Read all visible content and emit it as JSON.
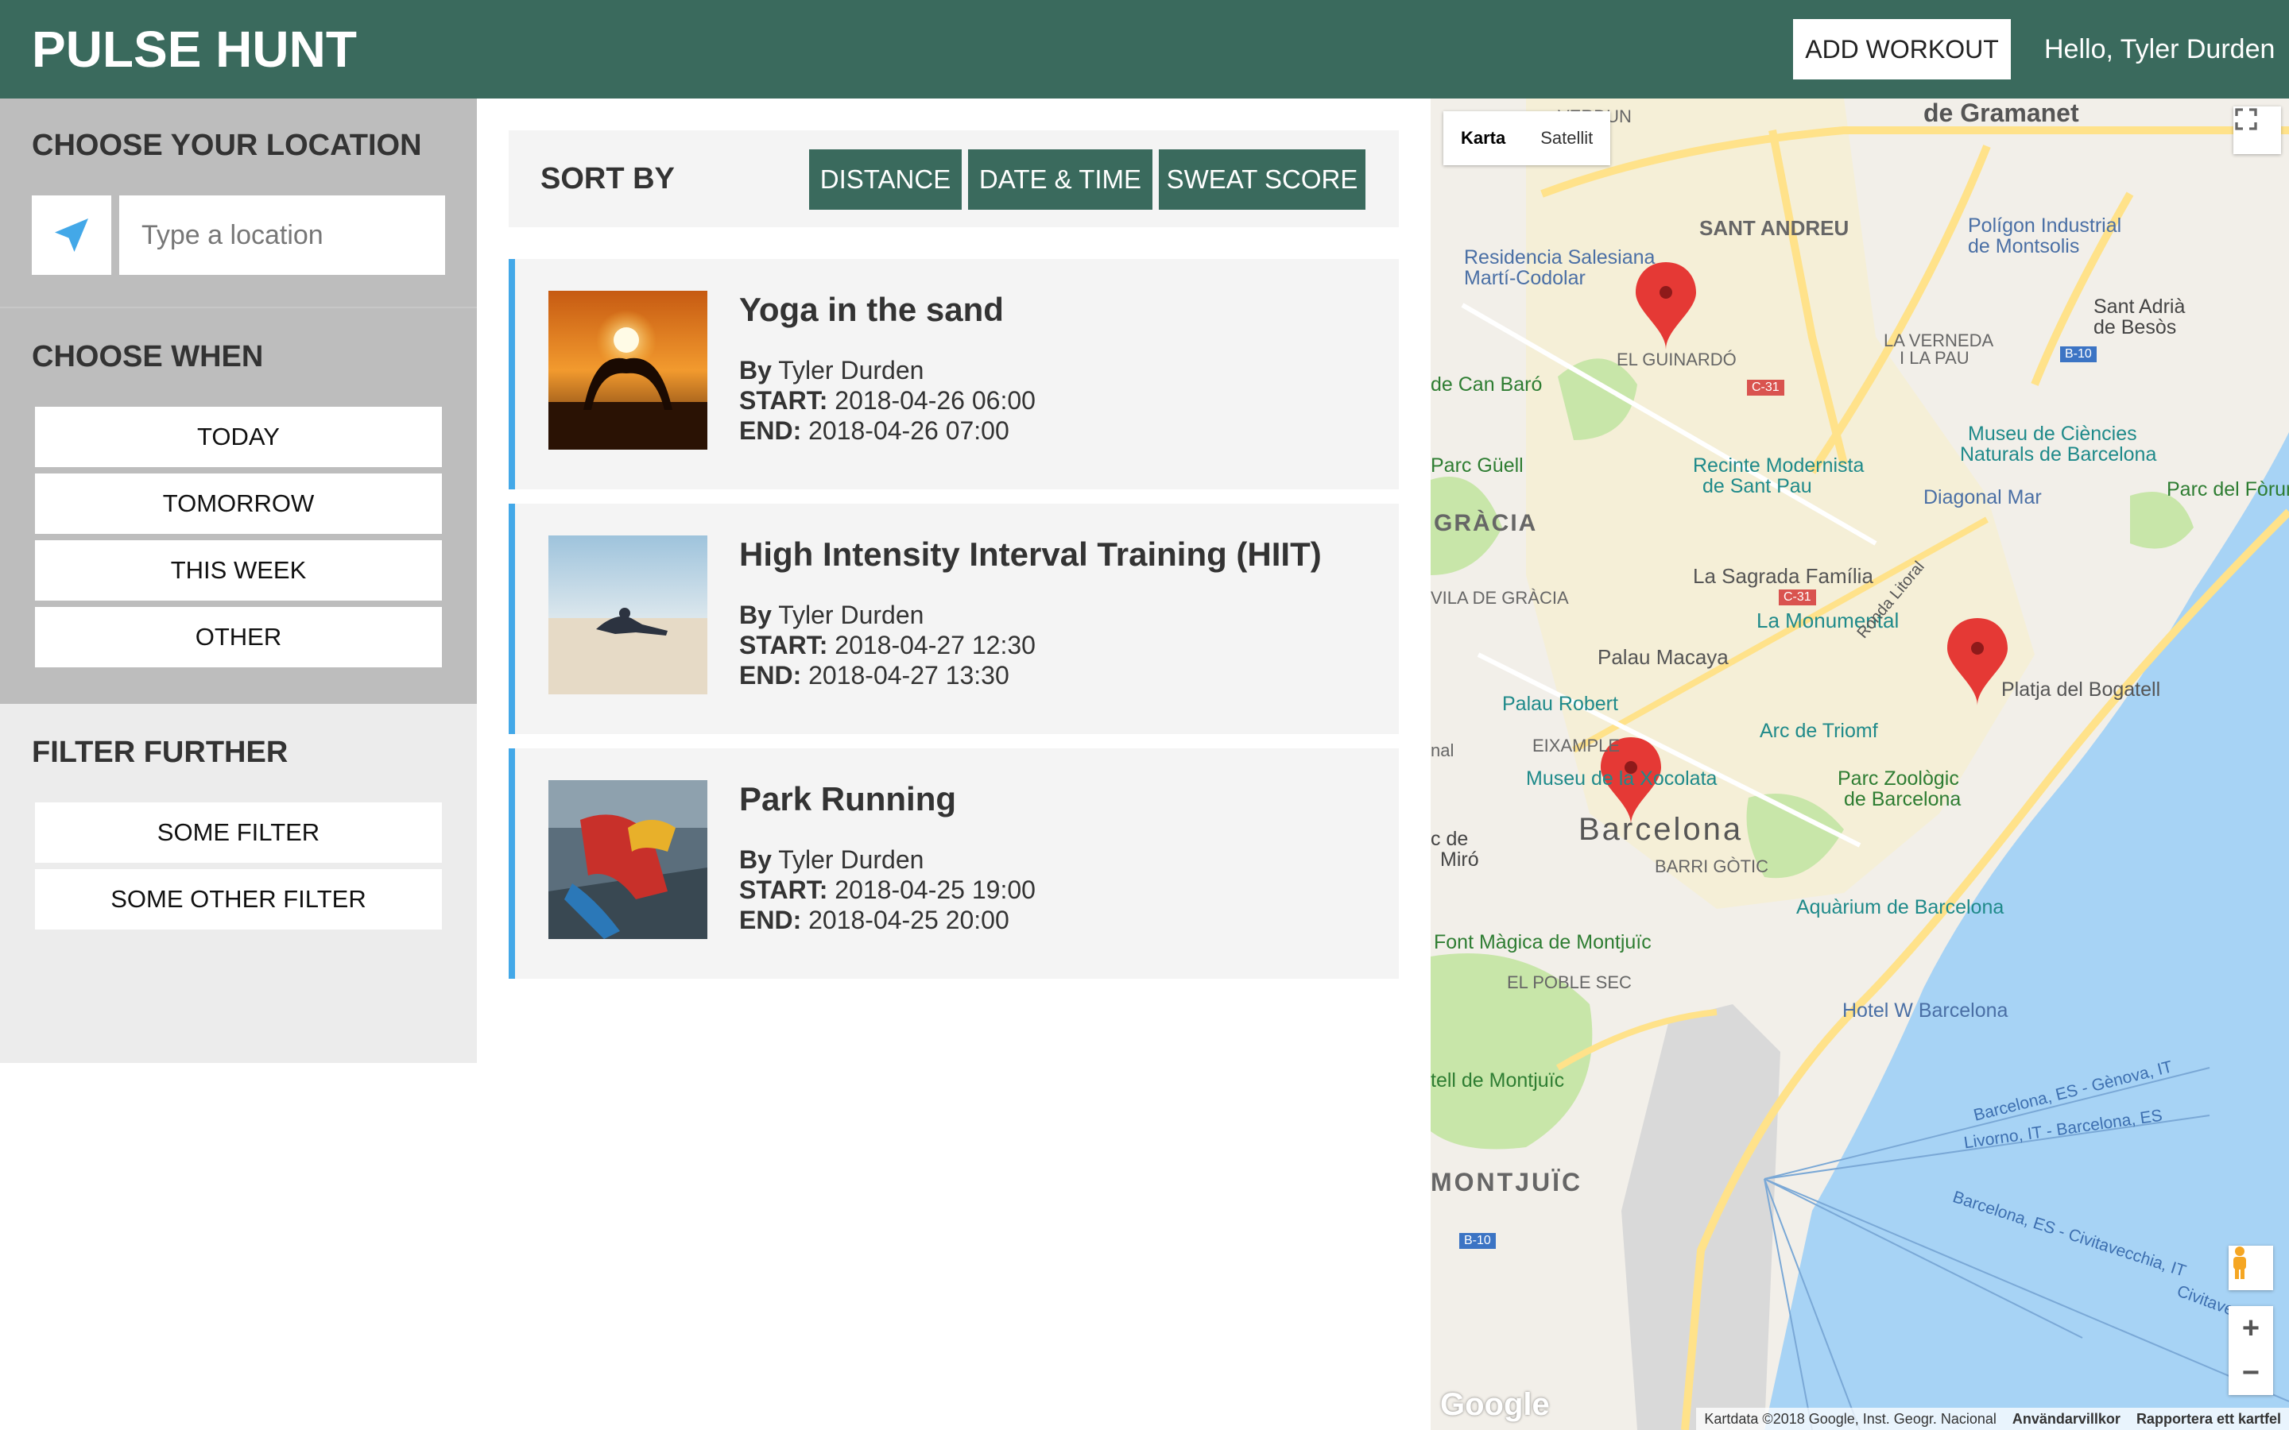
{
  "header": {
    "logo": "PULSE HUNT",
    "add_workout": "ADD WORKOUT",
    "greeting": "Hello, Tyler Durden"
  },
  "sidebar": {
    "location": {
      "title": "CHOOSE YOUR LOCATION",
      "placeholder": "Type a location",
      "icon": "navigation-arrow-icon"
    },
    "when": {
      "title": "CHOOSE WHEN",
      "options": [
        "TODAY",
        "TOMORROW",
        "THIS WEEK",
        "OTHER"
      ]
    },
    "filter": {
      "title": "FILTER FURTHER",
      "options": [
        "SOME FILTER",
        "SOME OTHER FILTER"
      ]
    }
  },
  "sort": {
    "label": "SORT BY",
    "options": [
      "DISTANCE",
      "DATE & TIME",
      "SWEAT SCORE"
    ]
  },
  "workouts": [
    {
      "title": "Yoga in the sand",
      "by_label": "By",
      "by": "Tyler Durden",
      "start_label": "START:",
      "start": "2018-04-26 06:00",
      "end_label": "END:",
      "end": "2018-04-26 07:00"
    },
    {
      "title": "High Intensity Interval Training (HIIT)",
      "by_label": "By",
      "by": "Tyler Durden",
      "start_label": "START:",
      "start": "2018-04-27 12:30",
      "end_label": "END:",
      "end": "2018-04-27 13:30"
    },
    {
      "title": "Park Running",
      "by_label": "By",
      "by": "Tyler Durden",
      "start_label": "START:",
      "start": "2018-04-25 19:00",
      "end_label": "END:",
      "end": "2018-04-25 20:00"
    }
  ],
  "map": {
    "type_options": [
      "Karta",
      "Satellit"
    ],
    "labels": {
      "gramanet": "de Gramanet",
      "verdun": "VERDUN",
      "sant_andreu": "SANT ANDREU",
      "poligon1": "Polígon Industrial",
      "poligon2": "de Montsolis",
      "residencia1": "Residencia Salesiana",
      "residencia2": "Martí-Codolar",
      "guinardo": "EL GUINARDÓ",
      "verneda1": "LA VERNEDA",
      "verneda2": "I LA PAU",
      "sant_adria1": "Sant Adrià",
      "sant_adria2": "de Besòs",
      "can_baro": "de Can Baró",
      "museu1": "Museu de Ciències",
      "museu2": "Naturals de Barcelona",
      "parc_guell": "Parc Güell",
      "recinte1": "Recinte Modernista",
      "recinte2": "de Sant Pau",
      "diagonal_mar": "Diagonal Mar",
      "parc_forum": "Parc del Fòrum",
      "gracia": "GRÀCIA",
      "sagrada": "La Sagrada Família",
      "vila_gracia": "VILA DE GRÀCIA",
      "monumental": "La Monumental",
      "palau_macaya": "Palau Macaya",
      "platja": "Platja del Bogatell",
      "palau_robert": "Palau Robert",
      "arc": "Arc de Triomf",
      "eixample": "EIXAMPLE",
      "museu_xoc": "Museu de la Xocolata",
      "zoo1": "Parc Zoològic",
      "zoo2": "de Barcelona",
      "barcelona": "Barcelona",
      "barri_gotic": "BARRI GÒTIC",
      "miro1": "c de",
      "miro2": "Miró",
      "aquarium": "Aquàrium de Barcelona",
      "font_magica": "Font Màgica de Montjuïc",
      "poble_sec": "EL POBLE SEC",
      "hotel_w": "Hotel W Barcelona",
      "castell": "tell de Montjuïc",
      "montjuic": "MONTJUÏC",
      "ronda": "Ronda Litoral",
      "ferry1": "Barcelona, ES - Gènova, IT",
      "ferry2": "Livorno, IT - Barcelona, ES",
      "ferry3": "Barcelona, ES - Civitavecchia, IT",
      "ferry4": "Civitavecchia",
      "road_c31": "C-31",
      "road_b10": "B-10",
      "nal": "nal"
    },
    "google": "Google",
    "attribution": [
      "Kartdata ©2018 Google, Inst. Geogr. Nacional",
      "Användarvillkor",
      "Rapportera ett kartfel"
    ],
    "colors": {
      "land": "#f2efe9",
      "water": "#a7d3f5",
      "park": "#c8e6a9",
      "road": "#ffe28a",
      "marker": "#e53935"
    }
  },
  "colors": {
    "brand": "#3a6a5d",
    "accent": "#43a8e8",
    "sidebar_dark": "#bdbdbd",
    "sidebar_light": "#ececec",
    "card": "#f4f4f4"
  }
}
